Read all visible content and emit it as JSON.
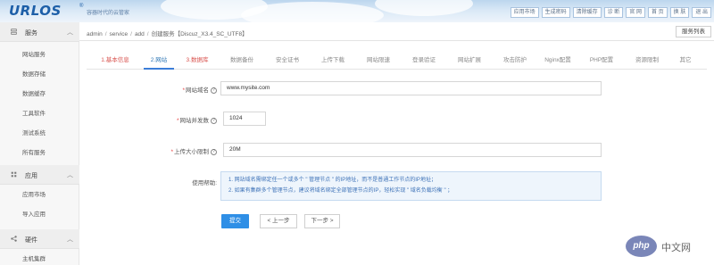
{
  "header": {
    "logo": "URLOS",
    "logo_mark": "®",
    "slogan": "容器时代的云管家",
    "nav": [
      "应用市场",
      "生成密码",
      "清除缓存",
      "诊 断",
      "官 网",
      "首 页",
      "换 肤",
      "退 出"
    ]
  },
  "sidebar": {
    "groups": [
      {
        "title": "服务",
        "icon": "server-icon",
        "items": [
          "网站服务",
          "数据存储",
          "数据缓存",
          "工具软件",
          "测试系统",
          "所有服务"
        ]
      },
      {
        "title": "应用",
        "icon": "grid-icon",
        "items": [
          "应用市场",
          "导入应用"
        ]
      },
      {
        "title": "硬件",
        "icon": "share-icon",
        "items": [
          "主机集群"
        ]
      }
    ]
  },
  "breadcrumb": {
    "items": [
      "admin",
      "service",
      "add"
    ],
    "current": "创建服务【Discuz_X3.4_SC_UTF8】"
  },
  "service_list_button": "服务列表",
  "tabs": [
    "1.基本信息",
    "2.网站",
    "3.数据库",
    "数据备份",
    "安全证书",
    "上传下载",
    "网站限速",
    "登录验证",
    "网站扩展",
    "攻击防护",
    "Nginx配置",
    "PHP配置",
    "资源限制",
    "其它"
  ],
  "form": {
    "domain": {
      "label": "网站域名",
      "value": "www.mysite.com"
    },
    "concurrency": {
      "label": "网站并发数",
      "value": "1024"
    },
    "upload_limit": {
      "label": "上传大小限制",
      "value": "20M"
    },
    "help": {
      "label": "使用帮助:",
      "lines": [
        "1. 网站域名需绑定任一个或多个 \" 管理节点 \" 的IP地址，而不是普通工作节点的IP地址；",
        "2. 如果有集群多个管理节点，建议将域名绑定全部管理节点的IP，轻松实现 \" 域名负载均衡 \" ；"
      ]
    }
  },
  "actions": {
    "submit": "提交",
    "prev": "< 上一步",
    "next": "下一步 >"
  },
  "watermark": {
    "badge": "php",
    "text": "中文网"
  },
  "colors": {
    "accent": "#2f8fe6",
    "done_tab": "#d9534f",
    "help_text": "#3f73b8"
  }
}
